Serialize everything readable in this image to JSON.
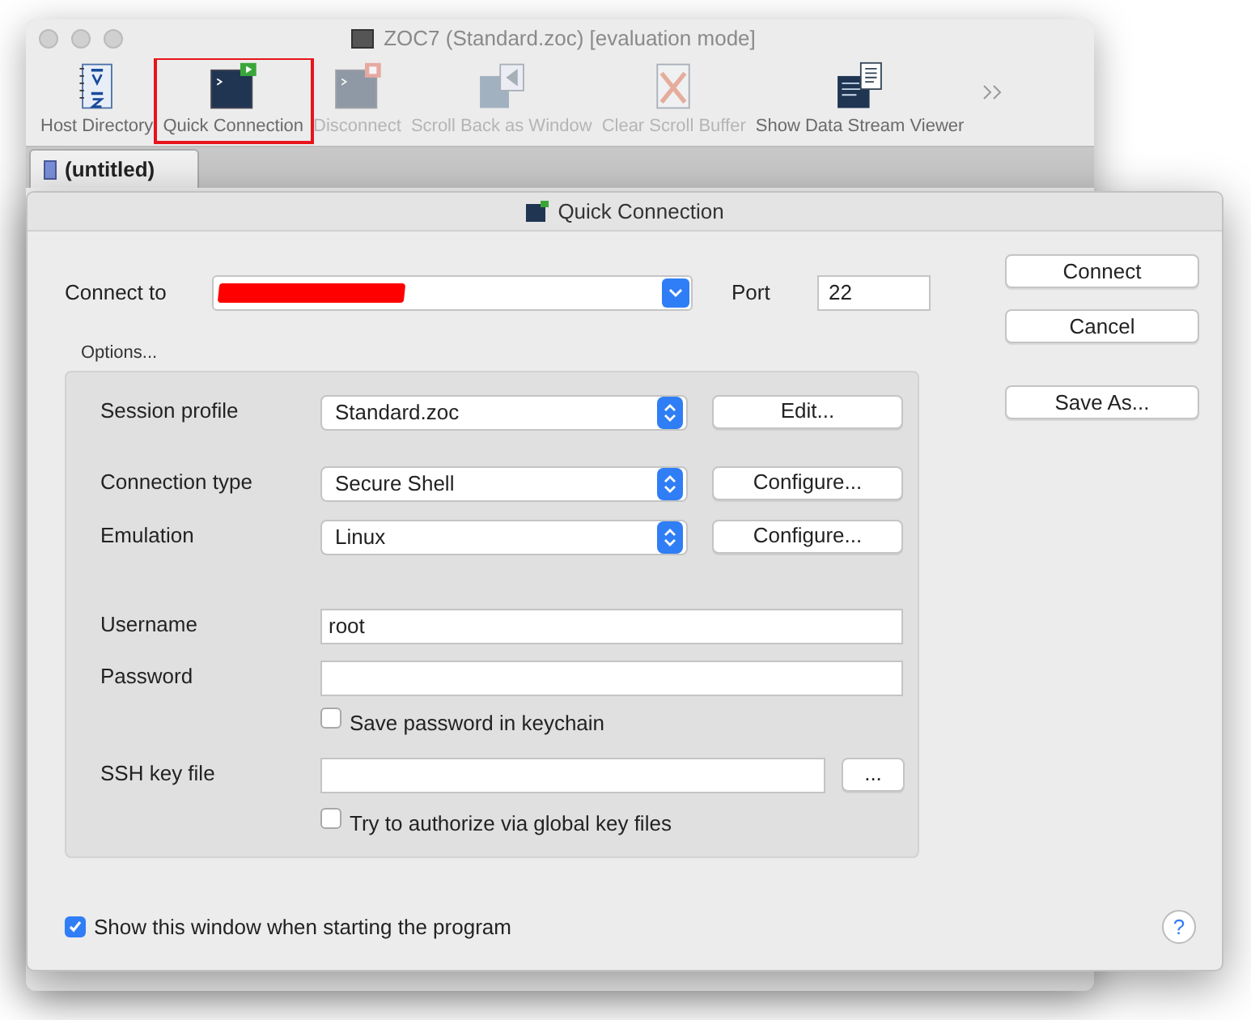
{
  "window": {
    "title": "ZOC7 (Standard.zoc) [evaluation mode]"
  },
  "toolbar": [
    {
      "label": "Host Directory",
      "kind": "directory",
      "disabled": false,
      "highlighted": false
    },
    {
      "label": "Quick Connection",
      "kind": "connect",
      "disabled": false,
      "highlighted": true
    },
    {
      "label": "Disconnect",
      "kind": "disconnect",
      "disabled": true,
      "highlighted": false
    },
    {
      "label": "Scroll Back as Window",
      "kind": "scrollback",
      "disabled": true,
      "highlighted": false
    },
    {
      "label": "Clear Scroll Buffer",
      "kind": "clear",
      "disabled": true,
      "highlighted": false
    },
    {
      "label": "Show Data Stream Viewer",
      "kind": "stream",
      "disabled": false,
      "highlighted": false
    }
  ],
  "tabs": [
    {
      "label": "(untitled)",
      "selected": true
    }
  ],
  "dialog": {
    "title": "Quick Connection",
    "connect_to": {
      "label": "Connect to",
      "redacted": true
    },
    "port": {
      "label": "Port",
      "value": "22"
    },
    "buttons": [
      {
        "label": "Connect",
        "default": false
      },
      {
        "label": "Cancel",
        "default": false
      },
      {
        "label": "Save As...",
        "default": false
      }
    ],
    "options": {
      "label": "Options...",
      "rows": [
        {
          "kind": "select",
          "label": "Session profile",
          "value": "Standard.zoc",
          "button": "Edit..."
        },
        {
          "kind": "select",
          "label": "Connection type",
          "value": "Secure Shell",
          "button": "Configure..."
        },
        {
          "kind": "select",
          "label": "Emulation",
          "value": "Linux",
          "button": "Configure..."
        },
        {
          "kind": "field",
          "label": "Username",
          "value": "root"
        },
        {
          "kind": "field",
          "label": "Password",
          "value": ""
        },
        {
          "kind": "checkbox",
          "label": "Save password in keychain",
          "checked": false
        },
        {
          "kind": "file",
          "label": "SSH key file",
          "value": "",
          "button": "..."
        },
        {
          "kind": "checkbox",
          "label": "Try to authorize via global key files",
          "checked": false
        }
      ]
    },
    "show_on_start": {
      "label": "Show this window when starting the program",
      "checked": true
    },
    "help": "?"
  }
}
